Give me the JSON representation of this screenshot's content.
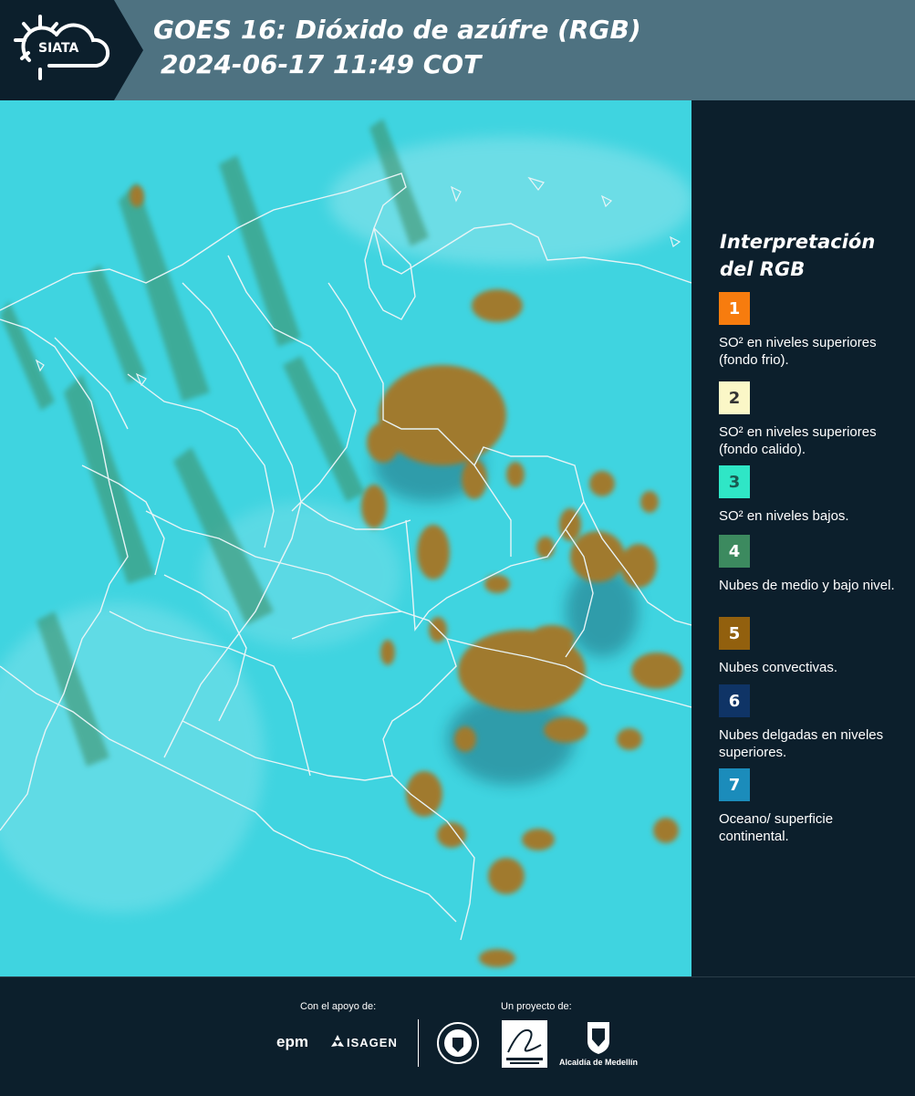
{
  "header": {
    "logo_text": "SIATA",
    "title_line1": "GOES 16: Dióxido de azúfre (RGB)",
    "title_line2": "2024-06-17 11:49 COT"
  },
  "map": {
    "background_color": "#3fd4e0",
    "border_color": "#e8f4f6",
    "cloud_color": "#a07a2e"
  },
  "legend": {
    "title": "Interpretación del RGB",
    "items": [
      {
        "number": "1",
        "color": "#f77c0e",
        "text_color": "#ffffff",
        "label": "SO² en niveles superiores (fondo frio)."
      },
      {
        "number": "2",
        "color": "#fbf7c7",
        "text_color": "#333333",
        "label": "SO² en niveles superiores (fondo calido)."
      },
      {
        "number": "3",
        "color": "#2fe6c6",
        "text_color": "#1a5a52",
        "label": "SO² en niveles bajos."
      },
      {
        "number": "4",
        "color": "#3c8a5f",
        "text_color": "#ffffff",
        "label": "Nubes de medio y bajo nivel."
      },
      {
        "number": "5",
        "color": "#92600e",
        "text_color": "#ffffff",
        "label": "Nubes convectivas."
      },
      {
        "number": "6",
        "color": "#0f3466",
        "text_color": "#ffffff",
        "label": "Nubes delgadas en niveles superiores."
      },
      {
        "number": "7",
        "color": "#1b8cbb",
        "text_color": "#ffffff",
        "label": "Oceano/ superficie continental."
      }
    ]
  },
  "footer": {
    "support_label": "Con el apoyo de:",
    "project_label": "Un proyecto de:",
    "sponsors": [
      "epm",
      "ISAGEN"
    ],
    "partner_captions": [
      "Alcaldía de Medellín"
    ]
  }
}
